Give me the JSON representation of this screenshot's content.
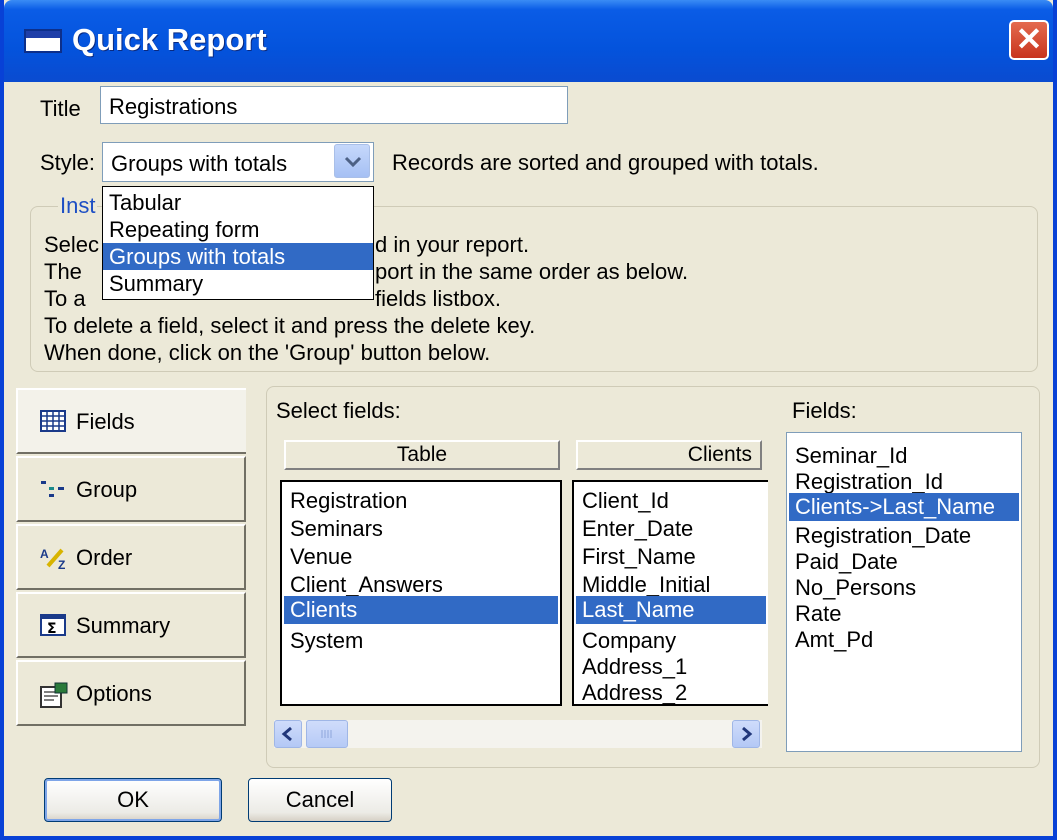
{
  "window": {
    "title": "Quick Report",
    "close_label": "✕"
  },
  "title_field": {
    "label": "Title",
    "value": "Registrations"
  },
  "style_field": {
    "label": "Style:",
    "value": "Groups with totals",
    "description": "Records are sorted and grouped with totals.",
    "options": [
      "Tabular",
      "Repeating form",
      "Groups with totals",
      "Summary"
    ],
    "selected_index": 2
  },
  "instructions": {
    "legend": "Inst",
    "lines": [
      {
        "left": "Selec",
        "right": "d in your report."
      },
      {
        "left": "The",
        "right": "port in the same order as below."
      },
      {
        "left": "To a",
        "right": "fields listbox."
      },
      {
        "left": "To delete a field, select it and press the delete key.",
        "right": ""
      },
      {
        "left": "When done, click on the 'Group' button below.",
        "right": ""
      }
    ]
  },
  "tabs": [
    {
      "label": "Fields",
      "icon": "fields-grid-icon"
    },
    {
      "label": "Group",
      "icon": "group-tree-icon"
    },
    {
      "label": "Order",
      "icon": "sort-az-icon"
    },
    {
      "label": "Summary",
      "icon": "sigma-icon"
    },
    {
      "label": "Options",
      "icon": "options-icon"
    }
  ],
  "select_fields": {
    "label": "Select fields:",
    "table_header": "Table",
    "tables": [
      "Registration",
      "Seminars",
      "Venue",
      "Client_Answers",
      "Clients",
      "System"
    ],
    "selected_table_index": 4,
    "column_header": "Clients",
    "columns": [
      "Client_Id",
      "Enter_Date",
      "First_Name",
      "Middle_Initial",
      "Last_Name",
      "Company",
      "Address_1",
      "Address_2"
    ],
    "selected_column_index": 4
  },
  "fields": {
    "label": "Fields:",
    "items": [
      "Seminar_Id",
      "Registration_Id",
      "Clients->Last_Name",
      "Registration_Date",
      "Paid_Date",
      "No_Persons",
      "Rate",
      "Amt_Pd"
    ],
    "selected_index": 2
  },
  "buttons": {
    "ok": "OK",
    "cancel": "Cancel"
  },
  "colors": {
    "titlebar": "#0453dc",
    "selection": "#316ac5",
    "dialog_bg": "#ece9d8",
    "close": "#c8341e"
  }
}
